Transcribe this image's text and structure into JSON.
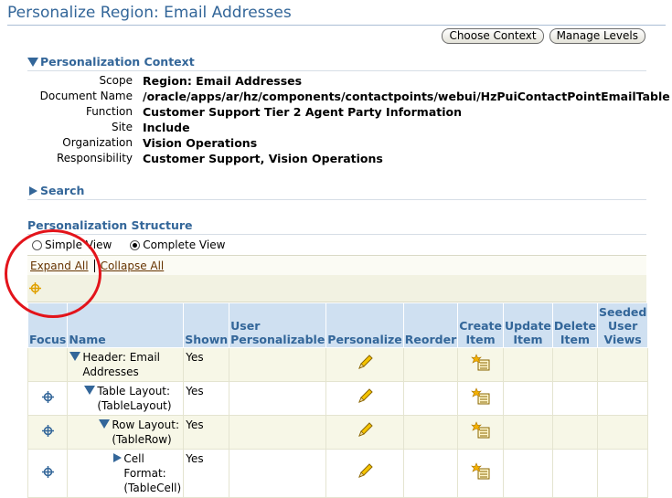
{
  "page": {
    "title": "Personalize Region: Email Addresses"
  },
  "buttons": {
    "choose_context": "Choose Context",
    "manage_levels": "Manage Levels"
  },
  "context": {
    "header": "Personalization Context",
    "rows": [
      {
        "label": "Scope",
        "value": "Region: Email Addresses"
      },
      {
        "label": "Document Name",
        "value": "/oracle/apps/ar/hz/components/contactpoints/webui/HzPuiContactPointEmailTable"
      },
      {
        "label": "Function",
        "value": "Customer Support Tier 2 Agent Party Information"
      },
      {
        "label": "Site",
        "value": "Include"
      },
      {
        "label": "Organization",
        "value": "Vision Operations"
      },
      {
        "label": "Responsibility",
        "value": "Customer Support, Vision Operations"
      }
    ]
  },
  "search": {
    "header": "Search"
  },
  "structure": {
    "header": "Personalization Structure",
    "view_simple": "Simple View",
    "view_complete": "Complete View",
    "selected_view": "Complete View",
    "expand_all": "Expand All",
    "collapse_all": "Collapse All",
    "columns": [
      "Focus",
      "Name",
      "Shown",
      "User Personalizable",
      "Personalize",
      "Reorder",
      "Create Item",
      "Update Item",
      "Delete Item",
      "Seeded User Views"
    ],
    "rows": [
      {
        "name_line1": "Header: Email",
        "name_line2": "Addresses",
        "shown": "Yes",
        "expand_icon": "collapse-triangle",
        "has_focus": false
      },
      {
        "name_line1": "Table Layout:",
        "name_line2": "(TableLayout)",
        "shown": "Yes",
        "expand_icon": "collapse-triangle",
        "has_focus": true
      },
      {
        "name_line1": "Row Layout:",
        "name_line2": "(TableRow)",
        "shown": "Yes",
        "expand_icon": "collapse-triangle",
        "has_focus": true
      },
      {
        "name_line1": "Cell Format:",
        "name_line2": "(TableCell)",
        "shown": "Yes",
        "expand_icon": "expand-triangle",
        "has_focus": true
      }
    ]
  },
  "annotation": {
    "color": "#e3141b"
  },
  "colors": {
    "title": "#336699",
    "header_bg": "#cfe0f1",
    "link": "#663300"
  }
}
